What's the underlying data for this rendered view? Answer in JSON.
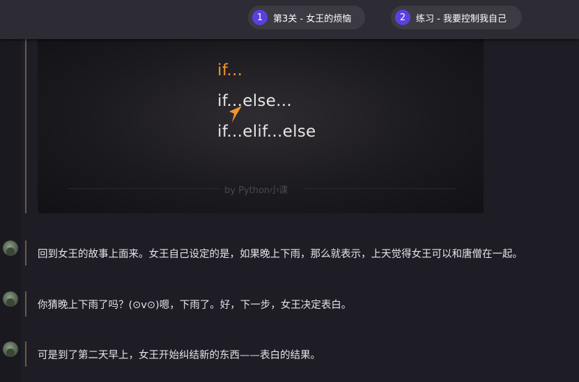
{
  "header": {
    "steps": [
      {
        "number": "1",
        "label": "第3关 - 女王的烦恼"
      },
      {
        "number": "2",
        "label": "练习 - 我要控制我自己"
      }
    ]
  },
  "slide": {
    "lines": [
      "if...",
      "if...else...",
      "if...elif...else"
    ],
    "credit": "by Python小课",
    "accent": "#f0962e"
  },
  "messages": [
    {
      "text": "回到女王的故事上面来。女王自己设定的是，如果晚上下雨，那么就表示，上天觉得女王可以和唐僧在一起。"
    },
    {
      "text": "你猜晚上下雨了吗？(⊙v⊙)嗯，下雨了。好，下一步，女王决定表白。"
    },
    {
      "text": "可是到了第二天早上，女王开始纠结新的东西——表白的结果。"
    }
  ],
  "colors": {
    "background": "#1e1d26",
    "topbar": "#2d2c34",
    "step_badge": "#5b40e0",
    "timeline": "#6b5a46"
  }
}
